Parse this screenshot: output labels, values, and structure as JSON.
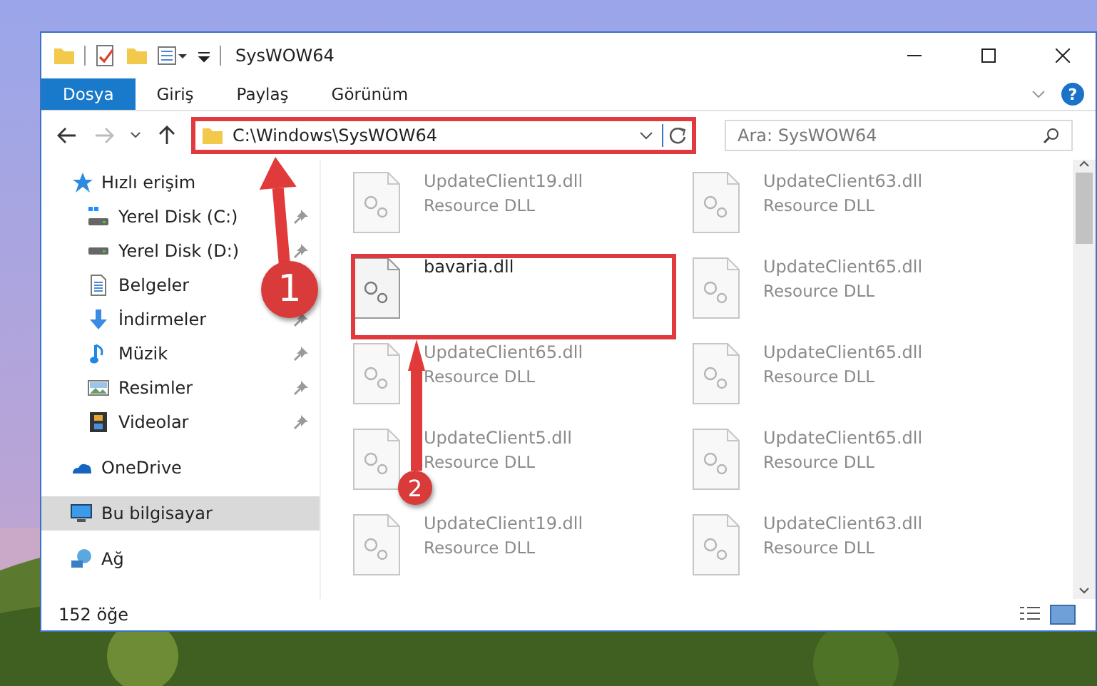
{
  "window": {
    "title": "SysWOW64"
  },
  "ribbon": {
    "tabs": [
      {
        "label": "Dosya",
        "selected": true
      },
      {
        "label": "Giriş",
        "selected": false
      },
      {
        "label": "Paylaş",
        "selected": false
      },
      {
        "label": "Görünüm",
        "selected": false
      }
    ],
    "help": "?"
  },
  "navigation": {
    "forward_disabled": true
  },
  "address": {
    "path": "C:\\Windows\\SysWOW64"
  },
  "search": {
    "placeholder": "Ara: SysWOW64"
  },
  "sidebar": {
    "items": [
      {
        "label": "Hızlı erişim",
        "selected": false,
        "children": [
          {
            "label": "Yerel Disk (C:)",
            "pinned": true
          },
          {
            "label": "Yerel Disk (D:)",
            "pinned": true
          },
          {
            "label": "Belgeler",
            "pinned": false
          },
          {
            "label": "İndirmeler",
            "pinned": true
          },
          {
            "label": "Müzik",
            "pinned": true
          },
          {
            "label": "Resimler",
            "pinned": true
          },
          {
            "label": "Videolar",
            "pinned": true
          }
        ]
      },
      {
        "label": "OneDrive",
        "selected": false
      },
      {
        "label": "Bu bilgisayar",
        "selected": true
      },
      {
        "label": "Ağ",
        "selected": false
      }
    ]
  },
  "files": [
    {
      "name": "UpdateClient19.dll",
      "type": "Resource DLL",
      "blurred": true
    },
    {
      "name": "UpdateClient63.dll",
      "type": "Resource DLL",
      "blurred": true
    },
    {
      "name": "bavaria.dll",
      "blurred": false
    },
    {
      "name": "UpdateClient65.dll",
      "type": "Resource DLL",
      "blurred": true
    },
    {
      "name": "UpdateClient65.dll",
      "type": "Resource DLL",
      "blurred": true
    },
    {
      "name": "UpdateClient65.dll",
      "type": "Resource DLL",
      "blurred": true
    },
    {
      "name": "UpdateClient5.dll",
      "type": "Resource DLL",
      "blurred": true
    },
    {
      "name": "UpdateClient65.dll",
      "type": "Resource DLL",
      "blurred": true
    },
    {
      "name": "UpdateClient19.dll",
      "type": "Resource DLL",
      "blurred": true
    },
    {
      "name": "UpdateClient63.dll",
      "type": "Resource DLL",
      "blurred": true
    }
  ],
  "status_bar": {
    "count": "152 öğe"
  },
  "annotations": [
    {
      "number": "1"
    },
    {
      "number": "2"
    }
  ]
}
